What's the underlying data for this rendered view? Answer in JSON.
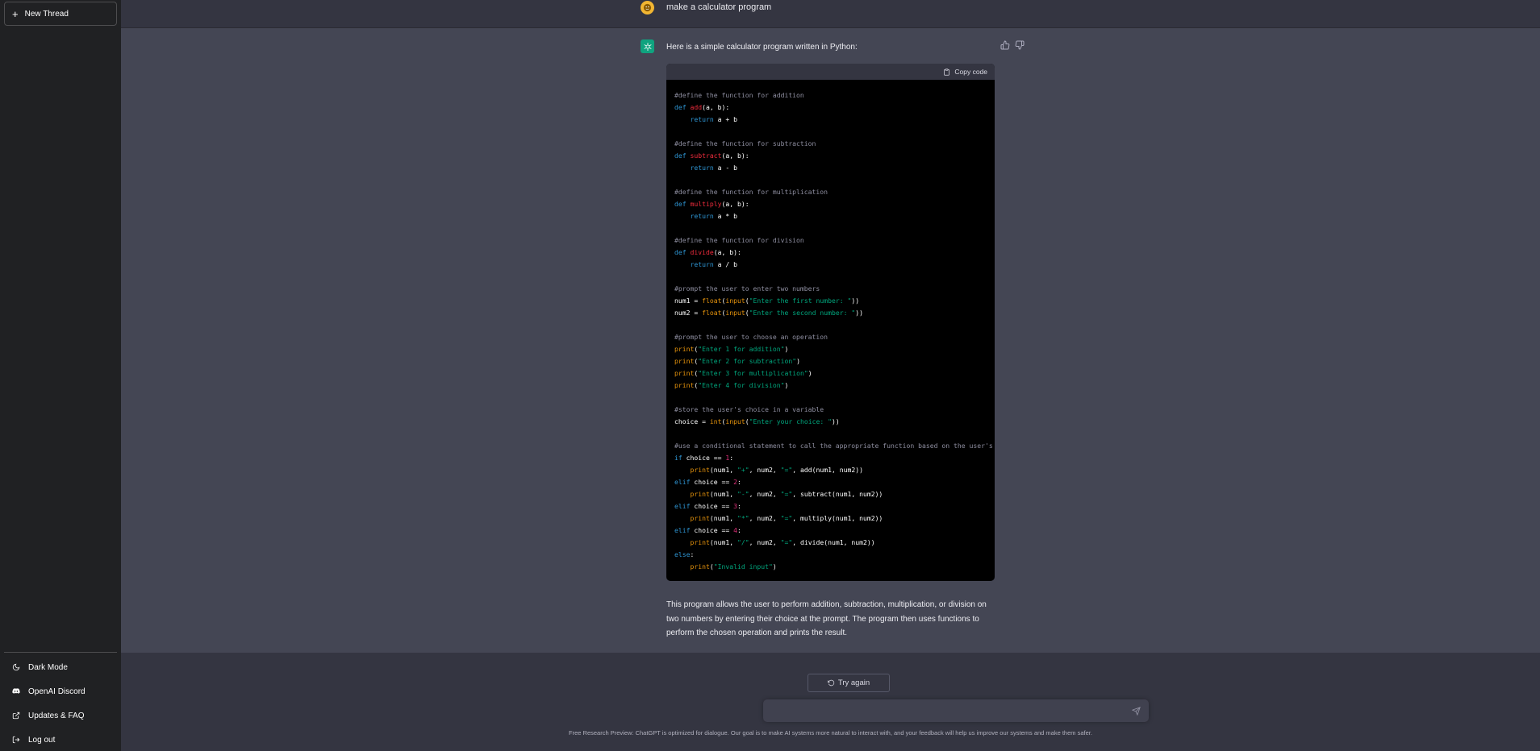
{
  "sidebar": {
    "new_thread_label": "New Thread",
    "bottom_items": [
      {
        "label": "Dark Mode",
        "icon": "moon-icon"
      },
      {
        "label": "OpenAI Discord",
        "icon": "discord-icon"
      },
      {
        "label": "Updates & FAQ",
        "icon": "external-link-icon"
      },
      {
        "label": "Log out",
        "icon": "logout-icon"
      }
    ]
  },
  "conversation": {
    "user_message": "make a calculator program",
    "assistant_intro": "Here is a simple calculator program written in Python:",
    "copy_code_label": "Copy code",
    "assistant_outro": "This program allows the user to perform addition, subtraction, multiplication, or division on two numbers by entering their choice at the prompt. The program then uses functions to perform the chosen operation and prints the result."
  },
  "code_lines": [
    "#define the function for addition",
    "def add(a, b):",
    "    return a + b",
    "",
    "#define the function for subtraction",
    "def subtract(a, b):",
    "    return a - b",
    "",
    "#define the function for multiplication",
    "def multiply(a, b):",
    "    return a * b",
    "",
    "#define the function for division",
    "def divide(a, b):",
    "    return a / b",
    "",
    "#prompt the user to enter two numbers",
    "num1 = float(input(\"Enter the first number: \"))",
    "num2 = float(input(\"Enter the second number: \"))",
    "",
    "#prompt the user to choose an operation",
    "print(\"Enter 1 for addition\")",
    "print(\"Enter 2 for subtraction\")",
    "print(\"Enter 3 for multiplication\")",
    "print(\"Enter 4 for division\")",
    "",
    "#store the user's choice in a variable",
    "choice = int(input(\"Enter your choice: \"))",
    "",
    "#use a conditional statement to call the appropriate function based on the user's choice",
    "if choice == 1:",
    "    print(num1, \"+\", num2, \"=\", add(num1, num2))",
    "elif choice == 2:",
    "    print(num1, \"-\", num2, \"=\", subtract(num1, num2))",
    "elif choice == 3:",
    "    print(num1, \"*\", num2, \"=\", multiply(num1, num2))",
    "elif choice == 4:",
    "    print(num1, \"/\", num2, \"=\", divide(num1, num2))",
    "else:",
    "    print(\"Invalid input\")"
  ],
  "footer": {
    "try_again_label": "Try again",
    "input_value": "",
    "disclaimer": "Free Research Preview: ChatGPT is optimized for dialogue. Our goal is to make AI systems more natural to interact with, and your feedback will help us improve our systems and make them safer."
  },
  "colors": {
    "sidebar_bg": "#202123",
    "main_bg": "#343541",
    "assistant_bg": "#444654",
    "code_bg": "#000000",
    "accent": "#10a37f",
    "comment": "#8e8ea0",
    "keyword": "#2e95d3",
    "function_name": "#f22c3d",
    "builtin": "#e9950c",
    "string": "#00a67d",
    "number": "#df3079"
  }
}
